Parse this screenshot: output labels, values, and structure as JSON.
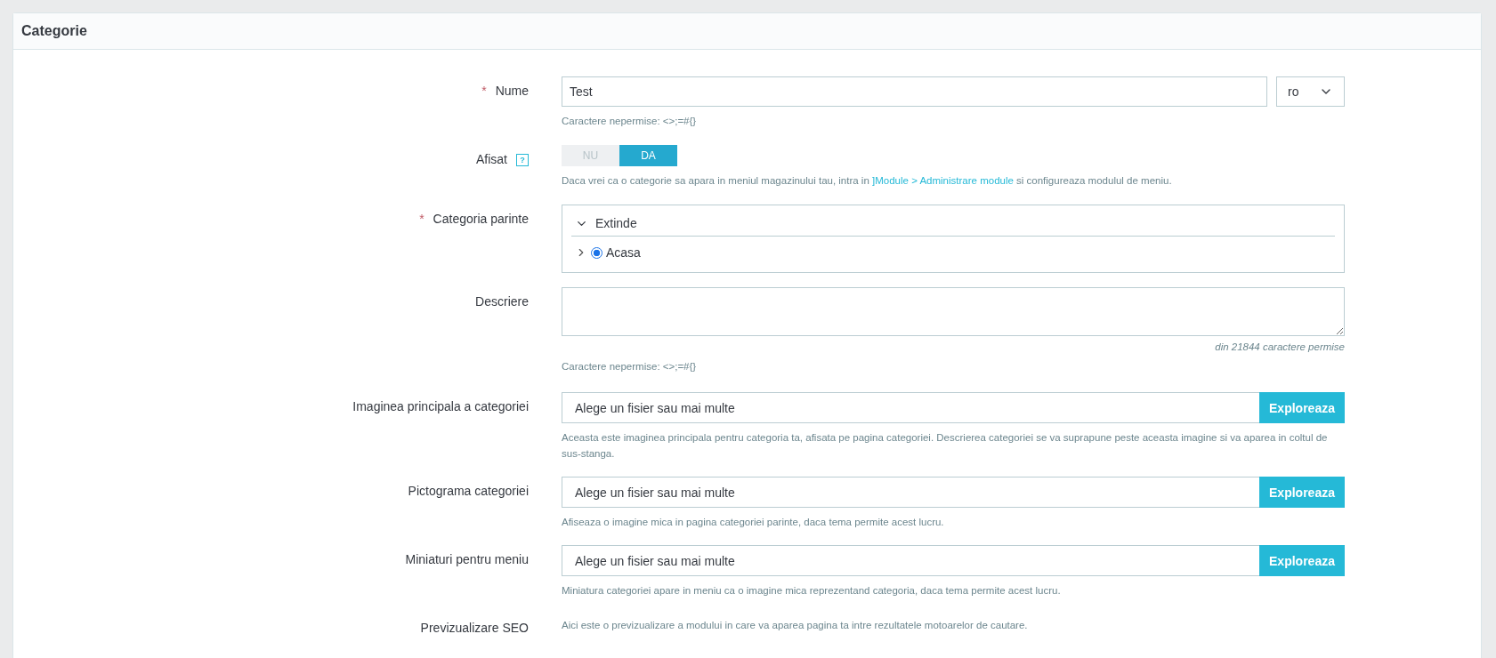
{
  "panel": {
    "title": "Categorie"
  },
  "fields": [
    {
      "kind": "text",
      "required_mark": "*",
      "label": "Nume",
      "value": "Test",
      "language": "ro",
      "hint": "Caractere nepermise: <>;=#{}"
    },
    {
      "kind": "toggle",
      "label": "Afisat",
      "help_icon": "?",
      "options": [
        {
          "label": "NU",
          "selected": false
        },
        {
          "label": "DA",
          "selected": true
        }
      ],
      "hint_parts": [
        {
          "kind": "plain",
          "text": "Daca vrei ca o categorie sa apara in meniul magazinului tau, intra in "
        },
        {
          "kind": "link",
          "text": "]Module > Administrare module"
        },
        {
          "kind": "plain",
          "text": " si configureaza modulul de meniu."
        }
      ]
    },
    {
      "kind": "tree",
      "required_mark": "*",
      "label": "Categoria parinte",
      "toggle_label": "Extinde",
      "nodes": [
        {
          "label": "Acasa",
          "selected": true
        }
      ]
    },
    {
      "kind": "textarea",
      "label": "Descriere",
      "counter": "din 21844 caractere permise",
      "hint": "Caractere nepermise: <>;=#{}"
    },
    {
      "kind": "file",
      "label": "Imaginea principala a categoriei",
      "placeholder": "Alege un fisier sau mai multe",
      "button": "Exploreaza",
      "hint": "Aceasta este imaginea principala pentru categoria ta, afisata pe pagina categoriei. Descrierea categoriei se va suprapune peste aceasta imagine si va aparea in coltul de sus-stanga."
    },
    {
      "kind": "file",
      "label": "Pictograma categoriei",
      "placeholder": "Alege un fisier sau mai multe",
      "button": "Exploreaza",
      "hint": "Afiseaza o imagine mica in pagina categoriei parinte, daca tema permite acest lucru."
    },
    {
      "kind": "file",
      "label": "Miniaturi pentru meniu",
      "placeholder": "Alege un fisier sau mai multe",
      "button": "Exploreaza",
      "hint": "Miniatura categoriei apare in meniu ca o imagine mica reprezentand categoria, daca tema permite acest lucru."
    },
    {
      "kind": "note",
      "label": "Previzualizare SEO",
      "hint": "Aici este o previzualizare a modului in care va aparea pagina ta intre rezultatele motoarelor de cautare."
    }
  ]
}
